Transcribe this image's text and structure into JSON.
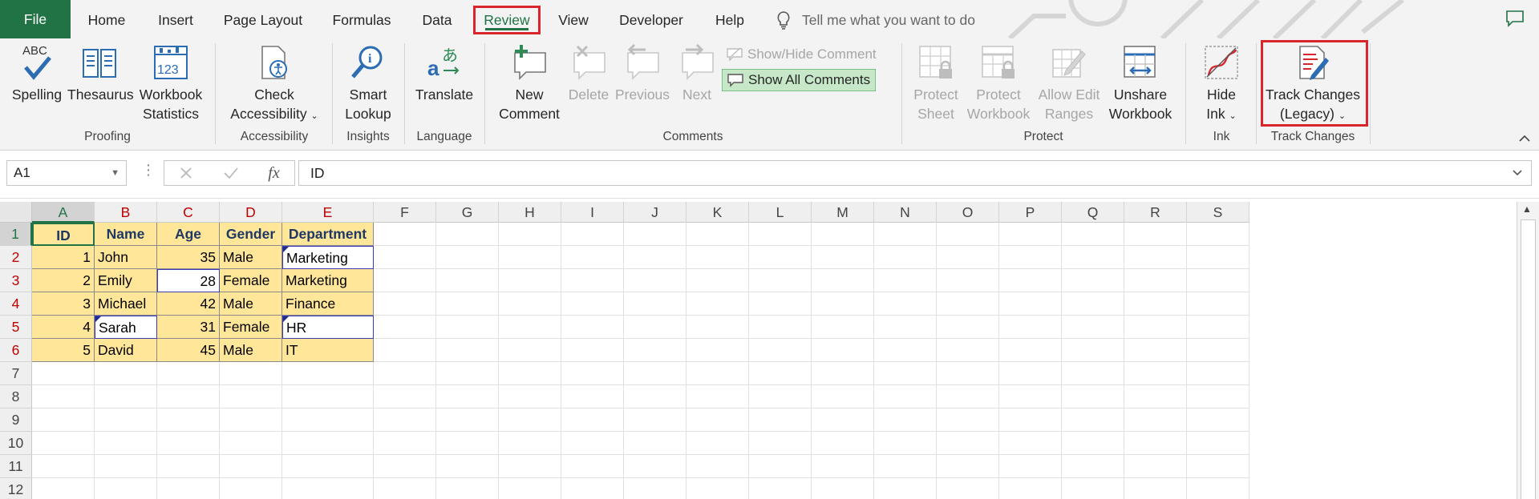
{
  "tabs": {
    "file": "File",
    "home": "Home",
    "insert": "Insert",
    "page_layout": "Page Layout",
    "formulas": "Formulas",
    "data": "Data",
    "review": "Review",
    "view": "View",
    "developer": "Developer",
    "help": "Help",
    "tell_me": "Tell me what you want to do"
  },
  "ribbon": {
    "proofing": {
      "spelling": "Spelling",
      "thesaurus": "Thesaurus",
      "workbook1": "Workbook",
      "workbook2": "Statistics",
      "group": "Proofing"
    },
    "accessibility": {
      "check1": "Check",
      "check2": "Accessibility",
      "group": "Accessibility"
    },
    "insights": {
      "smart1": "Smart",
      "smart2": "Lookup",
      "group": "Insights"
    },
    "language": {
      "translate": "Translate",
      "group": "Language"
    },
    "comments": {
      "new1": "New",
      "new2": "Comment",
      "delete": "Delete",
      "previous": "Previous",
      "next": "Next",
      "show_hide": "Show/Hide Comment",
      "show_all": "Show All Comments",
      "group": "Comments"
    },
    "protect": {
      "sheet1": "Protect",
      "sheet2": "Sheet",
      "workbook1": "Protect",
      "workbook2": "Workbook",
      "ranges1": "Allow Edit",
      "ranges2": "Ranges",
      "unshare1": "Unshare",
      "unshare2": "Workbook",
      "group": "Protect"
    },
    "ink": {
      "hide1": "Hide",
      "hide2": "Ink",
      "group": "Ink"
    },
    "track": {
      "tc1": "Track Changes",
      "tc2": "(Legacy)",
      "group": "Track Changes"
    }
  },
  "formula_bar": {
    "name_box": "A1",
    "formula": "ID",
    "fx": "fx"
  },
  "columns": [
    "A",
    "B",
    "C",
    "D",
    "E",
    "F",
    "G",
    "H",
    "I",
    "J",
    "K",
    "L",
    "M",
    "N",
    "O",
    "P",
    "Q",
    "R",
    "S"
  ],
  "rows": [
    "1",
    "2",
    "3",
    "4",
    "5",
    "6",
    "7",
    "8",
    "9",
    "10",
    "11",
    "12"
  ],
  "table": {
    "headers": [
      "ID",
      "Name",
      "Age",
      "Gender",
      "Department"
    ],
    "rows": [
      [
        "1",
        "John",
        "35",
        "Male",
        "Marketing"
      ],
      [
        "2",
        "Emily",
        "28",
        "Female",
        "Marketing"
      ],
      [
        "3",
        "Michael",
        "42",
        "Male",
        "Finance"
      ],
      [
        "4",
        "Sarah",
        "31",
        "Female",
        "HR"
      ],
      [
        "5",
        "David",
        "45",
        "Male",
        "IT"
      ]
    ]
  },
  "colors": {
    "excel_green": "#217346",
    "cell_fill": "#ffe699",
    "highlight_red": "#d9262c",
    "header_text": "#1f3864"
  }
}
